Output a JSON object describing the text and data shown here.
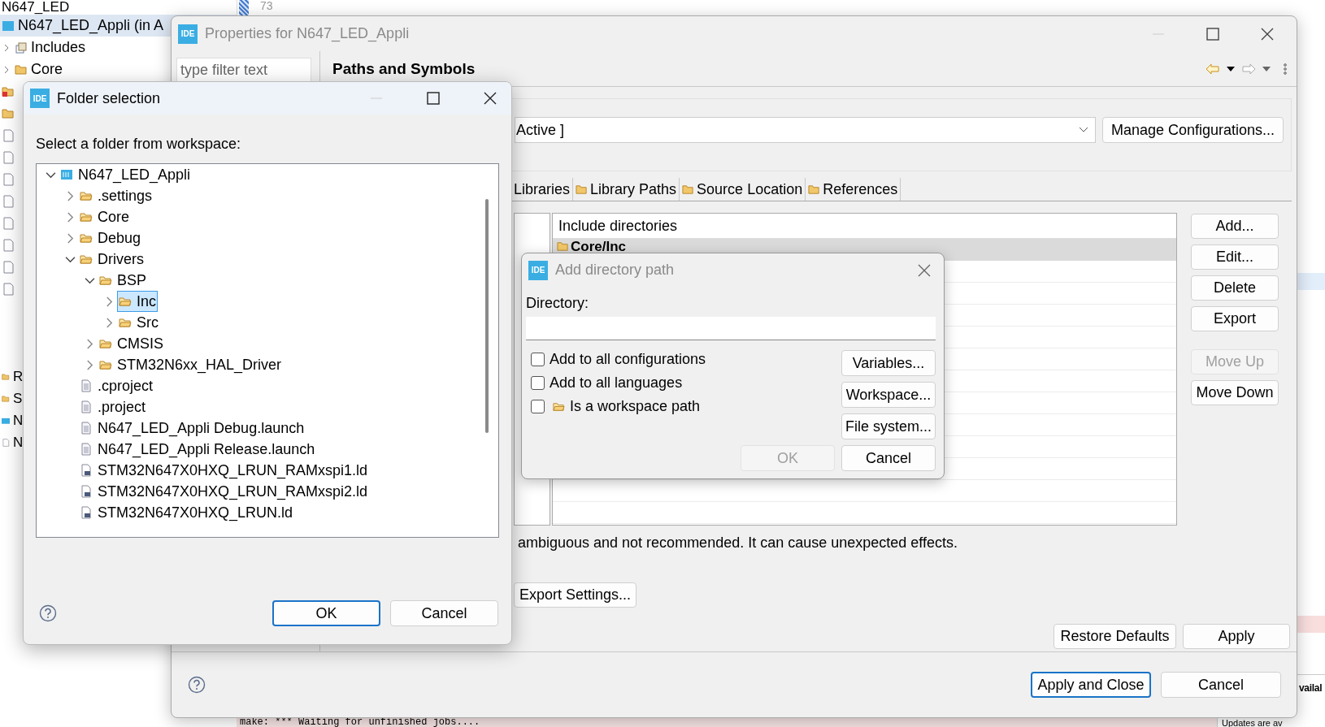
{
  "explorer": {
    "items": [
      {
        "label": "N647_LED",
        "kind": "text",
        "selected": false
      },
      {
        "label": "N647_LED_Appli (in A",
        "kind": "project",
        "selected": true
      },
      {
        "label": "Includes",
        "kind": "includes",
        "selected": false
      },
      {
        "label": "Core",
        "kind": "folder",
        "selected": false
      }
    ],
    "lower_items": [
      {
        "label": "R",
        "kind": "folder",
        "selected": false
      },
      {
        "label": "S",
        "kind": "folder",
        "selected": false
      },
      {
        "label": "N",
        "kind": "mx",
        "selected": false
      },
      {
        "label": "N",
        "kind": "file",
        "selected": false
      }
    ]
  },
  "editor": {
    "line_number": "73"
  },
  "console": {
    "text": "make: *** Waiting for unfinished jobs...."
  },
  "notification": {
    "title": "vailal",
    "text": "Updates are av"
  },
  "properties_dialog": {
    "logo": "IDE",
    "title": "Properties for N647_LED_Appli",
    "filter": {
      "placeholder": "type filter text"
    },
    "heading": "Paths and Symbols",
    "configuration": {
      "value": "Active ]"
    },
    "manage_button": "Manage Configurations...",
    "tabs": [
      {
        "label": "Libraries",
        "selected": false
      },
      {
        "label": "Library Paths",
        "selected": false
      },
      {
        "label": "Source Location",
        "selected": false
      },
      {
        "label": "References",
        "selected": false
      }
    ],
    "table": {
      "column": "Include directories",
      "rows": [
        {
          "label": "Core/Inc",
          "selected": true
        }
      ]
    },
    "side_buttons": [
      {
        "label": "Add...",
        "disabled": false
      },
      {
        "label": "Edit...",
        "disabled": false
      },
      {
        "label": "Delete",
        "disabled": false
      },
      {
        "label": "Export",
        "disabled": false
      },
      {
        "label": "Move Up",
        "disabled": true
      },
      {
        "label": "Move Down",
        "disabled": false
      }
    ],
    "note": "ambiguous and not recommended. It can cause unexpected effects.",
    "export_button": "Export Settings...",
    "restore_button": "Restore Defaults",
    "apply_button": "Apply",
    "footer_buttons": [
      {
        "label": "Apply and Close",
        "default": true
      },
      {
        "label": "Cancel",
        "default": false
      }
    ]
  },
  "folder_dialog": {
    "logo": "IDE",
    "title": "Folder selection",
    "prompt": "Select a folder from workspace:",
    "tree": [
      {
        "label": "N647_LED_Appli",
        "kind": "project",
        "expanded": true,
        "selected": false,
        "children": [
          {
            "label": ".settings",
            "kind": "folder",
            "expanded": false,
            "selected": false
          },
          {
            "label": "Core",
            "kind": "folder",
            "expanded": false,
            "selected": false
          },
          {
            "label": "Debug",
            "kind": "folder",
            "expanded": false,
            "selected": false
          },
          {
            "label": "Drivers",
            "kind": "folder",
            "expanded": true,
            "selected": false,
            "children": [
              {
                "label": "BSP",
                "kind": "folder",
                "expanded": true,
                "selected": false,
                "children": [
                  {
                    "label": "Inc",
                    "kind": "folder",
                    "expanded": false,
                    "selected": true
                  },
                  {
                    "label": "Src",
                    "kind": "folder",
                    "expanded": false,
                    "selected": false
                  }
                ]
              },
              {
                "label": "CMSIS",
                "kind": "folder",
                "expanded": false,
                "selected": false
              },
              {
                "label": "STM32N6xx_HAL_Driver",
                "kind": "folder",
                "expanded": false,
                "selected": false
              }
            ]
          },
          {
            "label": ".cproject",
            "kind": "file",
            "selected": false
          },
          {
            "label": ".project",
            "kind": "file",
            "selected": false
          },
          {
            "label": "N647_LED_Appli Debug.launch",
            "kind": "file",
            "selected": false
          },
          {
            "label": "N647_LED_Appli Release.launch",
            "kind": "file",
            "selected": false
          },
          {
            "label": "STM32N647X0HXQ_LRUN_RAMxspi1.ld",
            "kind": "linker",
            "selected": false
          },
          {
            "label": "STM32N647X0HXQ_LRUN_RAMxspi2.ld",
            "kind": "linker",
            "selected": false
          },
          {
            "label": "STM32N647X0HXQ_LRUN.ld",
            "kind": "linker",
            "selected": false
          }
        ]
      }
    ],
    "buttons": [
      {
        "label": "OK",
        "default": true
      },
      {
        "label": "Cancel",
        "default": false
      }
    ]
  },
  "add_dialog": {
    "logo": "IDE",
    "title": "Add directory path",
    "directory_label": "Directory:",
    "options": [
      {
        "label": "Add to all configurations",
        "kind": "plain",
        "checked": false
      },
      {
        "label": "Add to all languages",
        "kind": "plain",
        "checked": false
      },
      {
        "label": "Is a workspace path",
        "kind": "folder",
        "checked": false
      }
    ],
    "buttons": [
      "Variables...",
      "Workspace...",
      "File system..."
    ],
    "ok": {
      "label": "OK",
      "disabled": true
    },
    "cancel": "Cancel"
  }
}
